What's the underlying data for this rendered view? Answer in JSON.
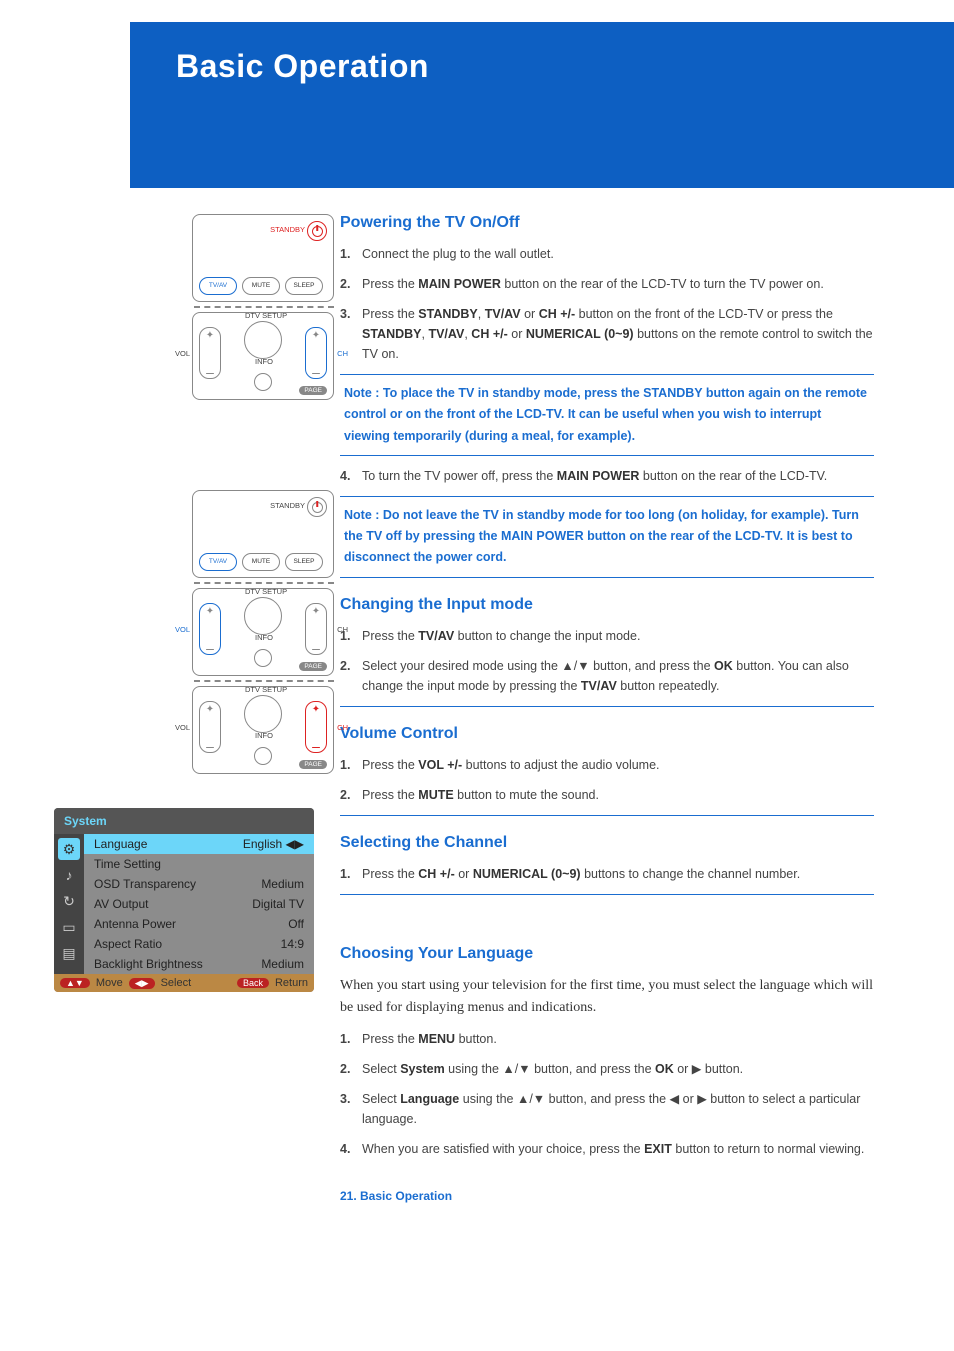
{
  "page_title": "Basic Operation",
  "footer": "21. Basic Operation",
  "sections": {
    "power": {
      "title": "Powering the TV On/Off",
      "step1": "Connect the plug to the wall outlet.",
      "step2_a": "Press the ",
      "step2_b": "MAIN POWER",
      "step2_c": " button on the rear of the LCD-TV to turn the TV power on.",
      "step3": "Press the <b>STANDBY</b>, <b>TV/AV</b> or <b>CH +/-</b> button on the front of the LCD-TV or press the <b>STANDBY</b>, <b>TV/AV</b>, <b>CH +/-</b> or <b>NUMERICAL (0~9)</b> buttons on the remote control to switch the TV on.",
      "note1": "Note : To place the TV in standby mode, press the STANDBY button again on the remote control or on the front of the LCD-TV. It can be useful when you wish to interrupt viewing temporarily (during a meal, for example).",
      "step4": "To turn the TV power off, press the <b>MAIN POWER</b> button on the rear of the LCD-TV.",
      "note2": "Note : Do not leave the TV in standby mode for too long (on holiday, for example). Turn the TV off by pressing the MAIN POWER button on the rear of the LCD-TV. It is best to disconnect the power cord."
    },
    "input": {
      "title": "Changing the Input mode",
      "step1": "Press the <b>TV/AV</b> button to change the input mode.",
      "step2": "Select your desired mode using the ▲/▼ button, and press the <b>OK</b> button. You can also change the input mode by pressing the <b>TV/AV</b> button repeatedly."
    },
    "volume": {
      "title": "Volume Control",
      "step1": "Press the <b>VOL +/-</b> buttons to adjust the audio volume.",
      "step2": "Press the <b>MUTE</b> button to mute the sound."
    },
    "channel": {
      "title": "Selecting the Channel",
      "step1": "Press the <b>CH +/-</b> or <b>NUMERICAL (0~9)</b> buttons to change the channel number."
    },
    "language": {
      "title": "Choosing Your Language",
      "intro": "When you start using your television for the first time,  you must select the language which will be used for displaying menus and indications.",
      "step1": "Press the <b>MENU</b> button.",
      "step2": "Select <b>System</b> using the ▲/▼ button, and press the <b>OK</b> or ▶ button.",
      "step3": "Select <b>Language</b> using the ▲/▼ button, and press the ◀ or ▶ button to select a particular language.",
      "step4": "When you are satisfied with your choice, press the <b>EXIT</b> button to return to normal viewing."
    }
  },
  "remote_labels": {
    "standby": "STANDBY",
    "tvav": "TV/AV",
    "mute": "MUTE",
    "sleep": "SLEEP",
    "dtv_setup": "DTV SETUP",
    "info": "INFO",
    "vol": "VOL",
    "ch": "CH",
    "page": "PAGE"
  },
  "osd": {
    "title": "System",
    "rows": [
      {
        "label": "Language",
        "value": "English ◀▶"
      },
      {
        "label": "Time Setting",
        "value": ""
      },
      {
        "label": "OSD Transparency",
        "value": "Medium"
      },
      {
        "label": "AV Output",
        "value": "Digital TV"
      },
      {
        "label": "Antenna Power",
        "value": "Off"
      },
      {
        "label": "Aspect Ratio",
        "value": "14:9"
      },
      {
        "label": "Backlight Brightness",
        "value": "Medium"
      }
    ],
    "footer": {
      "move": "Move",
      "select": "Select",
      "back": "Back",
      "return": "Return"
    }
  }
}
